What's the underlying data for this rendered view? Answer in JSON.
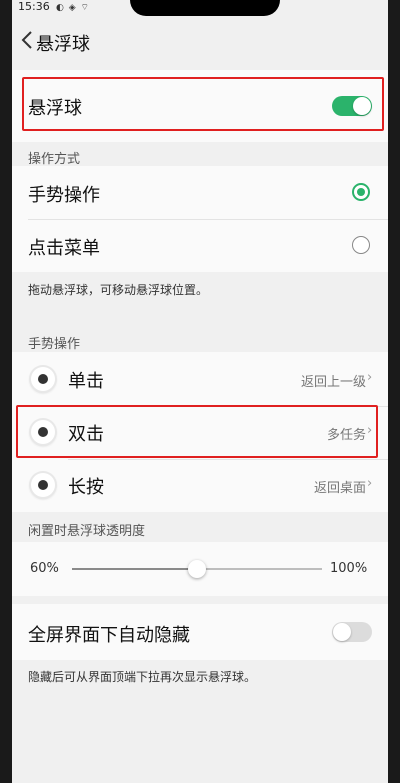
{
  "status_bar": {
    "time": "15:36",
    "icons": "◐ ◈ ⌔"
  },
  "header": {
    "title": "悬浮球"
  },
  "floating_ball": {
    "label": "悬浮球",
    "enabled": true
  },
  "operation_mode": {
    "section_label": "操作方式",
    "options": [
      {
        "label": "手势操作",
        "selected": true
      },
      {
        "label": "点击菜单",
        "selected": false
      }
    ],
    "hint": "拖动悬浮球，可移动悬浮球位置。"
  },
  "gestures": {
    "section_label": "手势操作",
    "items": [
      {
        "label": "单击",
        "value": "返回上一级"
      },
      {
        "label": "双击",
        "value": "多任务"
      },
      {
        "label": "长按",
        "value": "返回桌面"
      }
    ]
  },
  "opacity": {
    "section_label": "闲置时悬浮球透明度",
    "min_label": "60%",
    "max_label": "100%",
    "value_fraction": 0.5
  },
  "auto_hide": {
    "label": "全屏界面下自动隐藏",
    "enabled": false,
    "hint": "隐藏后可从界面顶端下拉再次显示悬浮球。"
  },
  "colors": {
    "accent": "#2bb36b",
    "highlight": "#e02020"
  }
}
